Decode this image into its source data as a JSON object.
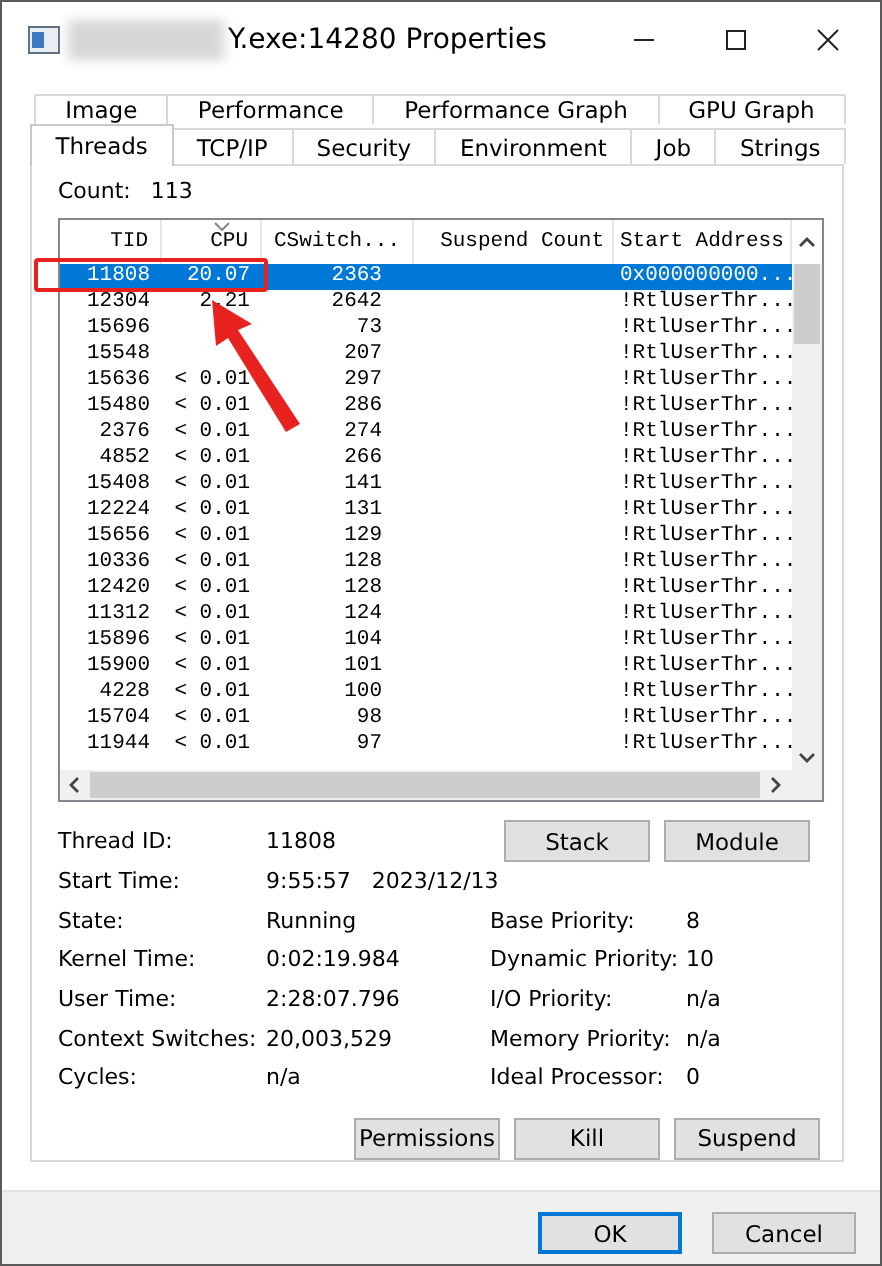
{
  "window": {
    "title": "Y.exe:14280 Properties"
  },
  "tab_rows": [
    [
      {
        "label": "Image",
        "selected": false
      },
      {
        "label": "Performance",
        "selected": false
      },
      {
        "label": "Performance Graph",
        "selected": false
      },
      {
        "label": "GPU Graph",
        "selected": false
      }
    ],
    [
      {
        "label": "Threads",
        "selected": true
      },
      {
        "label": "TCP/IP",
        "selected": false
      },
      {
        "label": "Security",
        "selected": false
      },
      {
        "label": "Environment",
        "selected": false
      },
      {
        "label": "Job",
        "selected": false
      },
      {
        "label": "Strings",
        "selected": false
      }
    ]
  ],
  "count": {
    "label": "Count:",
    "value": "113"
  },
  "table": {
    "columns": [
      {
        "label": "TID",
        "sorted": false
      },
      {
        "label": "CPU",
        "sorted": true
      },
      {
        "label": "CSwitch...",
        "sorted": false
      },
      {
        "label": "Suspend Count",
        "sorted": false
      },
      {
        "label": "Start Address",
        "sorted": false
      }
    ],
    "rows": [
      {
        "tid": "11808",
        "cpu": "20.07",
        "cswitch": "2363",
        "start": "0x000000000...",
        "selected": true
      },
      {
        "tid": "12304",
        "cpu": "2.21",
        "cswitch": "2642",
        "start": "!RtlUserThr...",
        "selected": false
      },
      {
        "tid": "15696",
        "cswitch": "73",
        "start": "!RtlUserThr...",
        "selected": false
      },
      {
        "tid": "15548",
        "cswitch": "207",
        "start": "!RtlUserThr...",
        "selected": false
      },
      {
        "tid": "15636",
        "cpu": "< 0.01",
        "cswitch": "297",
        "start": "!RtlUserThr...",
        "selected": false
      },
      {
        "tid": "15480",
        "cpu": "< 0.01",
        "cswitch": "286",
        "start": "!RtlUserThr...",
        "selected": false
      },
      {
        "tid": "2376",
        "cpu": "< 0.01",
        "cswitch": "274",
        "start": "!RtlUserThr...",
        "selected": false
      },
      {
        "tid": "4852",
        "cpu": "< 0.01",
        "cswitch": "266",
        "start": "!RtlUserThr...",
        "selected": false
      },
      {
        "tid": "15408",
        "cpu": "< 0.01",
        "cswitch": "141",
        "start": "!RtlUserThr...",
        "selected": false
      },
      {
        "tid": "12224",
        "cpu": "< 0.01",
        "cswitch": "131",
        "start": "!RtlUserThr...",
        "selected": false
      },
      {
        "tid": "15656",
        "cpu": "< 0.01",
        "cswitch": "129",
        "start": "!RtlUserThr...",
        "selected": false
      },
      {
        "tid": "10336",
        "cpu": "< 0.01",
        "cswitch": "128",
        "start": "!RtlUserThr...",
        "selected": false
      },
      {
        "tid": "12420",
        "cpu": "< 0.01",
        "cswitch": "128",
        "start": "!RtlUserThr...",
        "selected": false
      },
      {
        "tid": "11312",
        "cpu": "< 0.01",
        "cswitch": "124",
        "start": "!RtlUserThr...",
        "selected": false
      },
      {
        "tid": "15896",
        "cpu": "< 0.01",
        "cswitch": "104",
        "start": "!RtlUserThr...",
        "selected": false
      },
      {
        "tid": "15900",
        "cpu": "< 0.01",
        "cswitch": "101",
        "start": "!RtlUserThr...",
        "selected": false
      },
      {
        "tid": "4228",
        "cpu": "< 0.01",
        "cswitch": "100",
        "start": "!RtlUserThr...",
        "selected": false
      },
      {
        "tid": "15704",
        "cpu": "< 0.01",
        "cswitch": "98",
        "start": "!RtlUserThr...",
        "selected": false
      },
      {
        "tid": "11944",
        "cpu": "< 0.01",
        "cswitch": "97",
        "start": "!RtlUserThr...",
        "selected": false
      }
    ]
  },
  "details_top": [
    {
      "label": "Thread ID:",
      "value": "11808"
    },
    {
      "label": "Start Time:",
      "value": "9:55:57   2023/12/13"
    }
  ],
  "top_buttons": [
    "Stack",
    "Module"
  ],
  "details_left": [
    {
      "label": "State:",
      "value": "Running"
    },
    {
      "label": "Kernel Time:",
      "value": "0:02:19.984"
    },
    {
      "label": "User Time:",
      "value": "2:28:07.796"
    },
    {
      "label": "Context Switches:",
      "value": "20,003,529"
    },
    {
      "label": "Cycles:",
      "value": "n/a"
    }
  ],
  "details_right": [
    {
      "label": "Base Priority:",
      "value": "8"
    },
    {
      "label": "Dynamic Priority:",
      "value": "10"
    },
    {
      "label": "I/O Priority:",
      "value": "n/a"
    },
    {
      "label": "Memory Priority:",
      "value": "n/a"
    },
    {
      "label": "Ideal Processor:",
      "value": "0"
    }
  ],
  "action_buttons": [
    "Permissions",
    "Kill",
    "Suspend"
  ],
  "dialog_buttons": [
    {
      "label": "OK",
      "default": true
    },
    {
      "label": "Cancel",
      "default": false
    }
  ]
}
